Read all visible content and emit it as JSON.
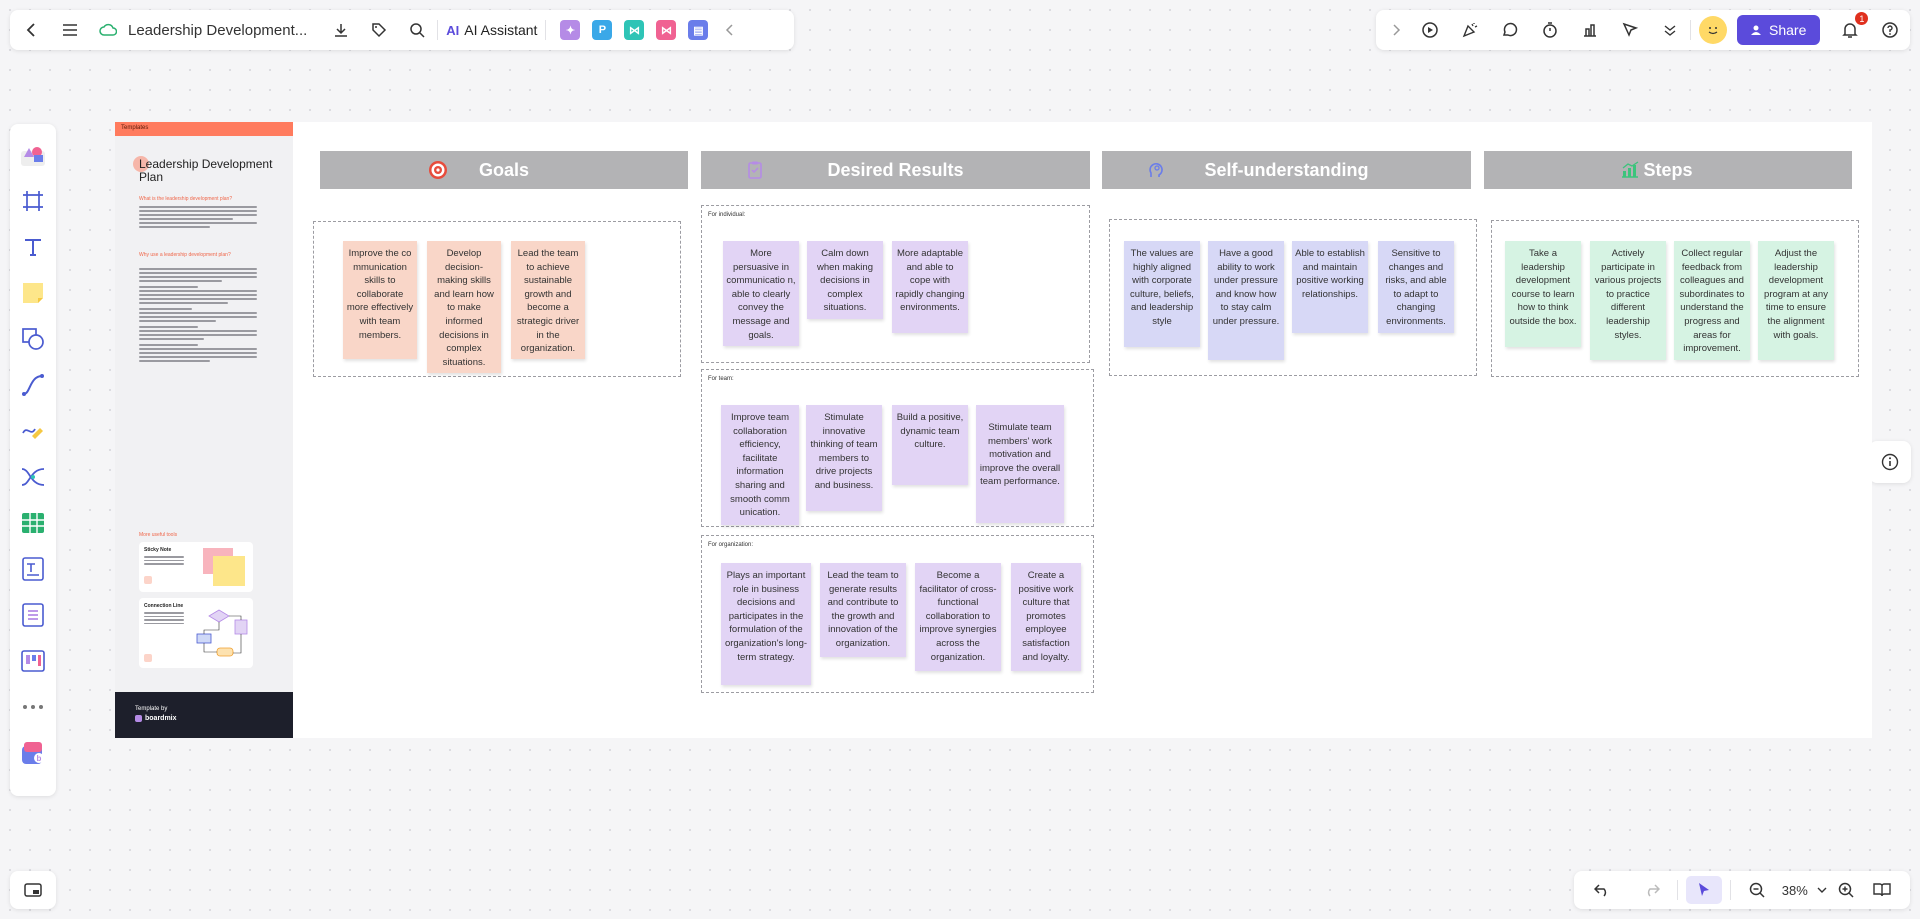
{
  "topbar": {
    "doc_title": "Leadership Development...",
    "ai_label": "AI Assistant",
    "ai_logo": "AI",
    "share_label": "Share",
    "notification_count": "1",
    "mini_apps": [
      {
        "name": "image-app",
        "glyph": "✦",
        "color": "#b58be6"
      },
      {
        "name": "presentation-app",
        "glyph": "P",
        "color": "#3aa8e8"
      },
      {
        "name": "flowchart-app",
        "glyph": "⋈",
        "color": "#2ec4b6"
      },
      {
        "name": "mindmap-app",
        "glyph": "⋈",
        "color": "#f06292"
      },
      {
        "name": "chat-app",
        "glyph": "▤",
        "color": "#6a7dea"
      }
    ]
  },
  "zoom": {
    "level": "38%"
  },
  "sidebar_doc": {
    "band_label": "Templates",
    "title": "Leadership Development Plan",
    "q1": "What is the leadership development plan?",
    "q2": "Why use a leadership development plan?",
    "tools_label": "More useful tools",
    "card1_title": "Sticky Note",
    "card2_title": "Connection Line",
    "footer_label": "Template by",
    "footer_brand": "boardmix"
  },
  "headers": {
    "goals": "Goals",
    "desired": "Desired Results",
    "self": "Self-understanding",
    "steps": "Steps"
  },
  "groups": {
    "individual": "For individual:",
    "team": "For team:",
    "organization": "For organization:"
  },
  "goals": [
    "Improve the co mmunication skills to collaborate more effectively with team members.",
    "Develop decision-making skills and learn how to make informed decisions in complex situations.",
    "Lead the team to achieve sustainable growth and become a strategic driver in the organization."
  ],
  "individual": [
    "More persuasive in communicatio n, able to clearly convey the message and goals.",
    "Calm down when making decisions in complex situations.",
    "More adaptable and able to cope with rapidly changing environments."
  ],
  "team": [
    "Improve team collaboration efficiency, facilitate information sharing and smooth comm unication.",
    "Stimulate innovative thinking of team members to drive projects and business.",
    "Build a positive, dynamic team culture.",
    "Stimulate team members' work motivation and improve the overall team performance."
  ],
  "organization": [
    "Plays an important role in business decisions and participates in the formulation of the organization's long-term strategy.",
    "Lead the team to generate results and contribute to the growth and innovation of the organization.",
    "Become a facilitator of cross-functional collaboration to improve synergies across the organization.",
    "Create a positive work culture that promotes employee satisfaction and loyalty."
  ],
  "self": [
    "The values are highly aligned with corporate culture, beliefs, and leadership style",
    "Have a good ability to work under pressure and know how to stay calm under pressure.",
    "Able to establish and maintain positive working relationships.",
    "Sensitive to changes and risks, and able to adapt to changing environments."
  ],
  "steps": [
    "Take a leadership development course to learn how to think outside the box.",
    "Actively participate in various projects to practice different leadership styles.",
    "Collect regular feedback from colleagues and subordinates to understand the progress and areas for improvement.",
    "Adjust the leadership development program at any time to ensure the alignment with goals."
  ],
  "colors": {
    "accent": "#5b4bdb",
    "header_gray": "#b3b3b5",
    "note_orange": "#f9d6c8",
    "note_purple": "#e2d4f5",
    "note_blue": "#d7d8f6",
    "note_green": "#d6f3e3"
  }
}
